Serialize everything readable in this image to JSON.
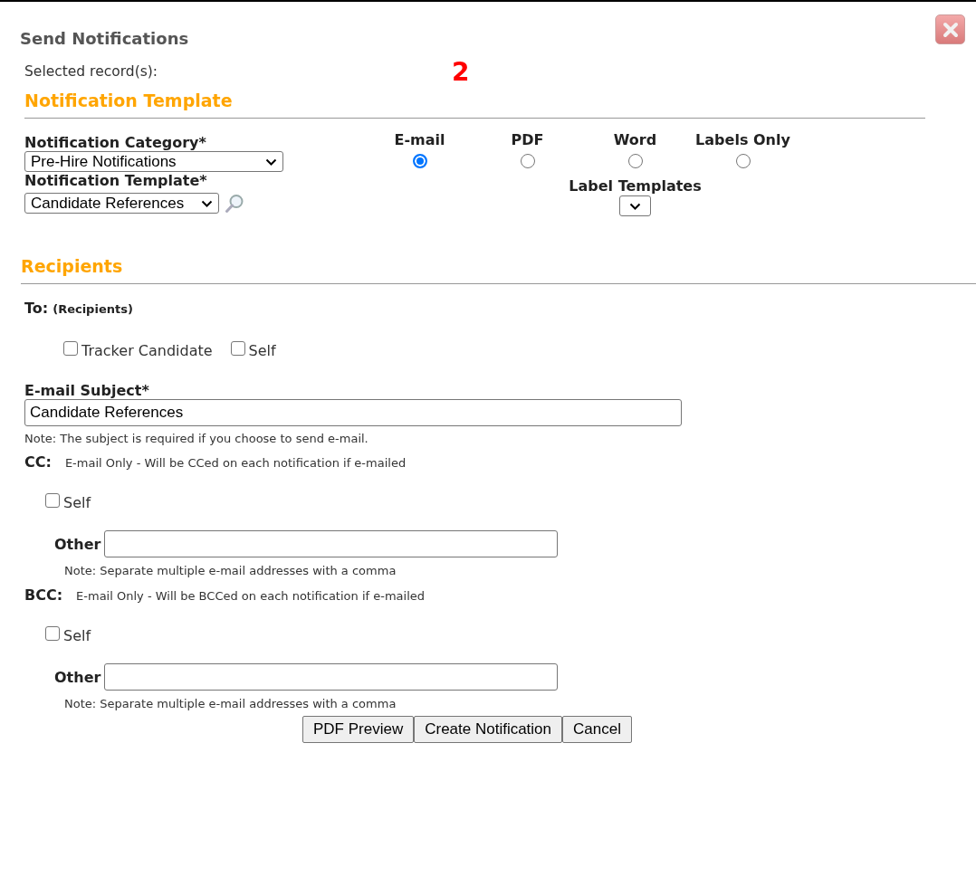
{
  "dialog": {
    "title": "Send Notifications"
  },
  "selected_records": {
    "label": "Selected record(s):",
    "count": "2"
  },
  "template_section": {
    "heading": "Notification Template",
    "fields": [
      {
        "label": "Notification Category*",
        "value": "Pre-Hire Notifications"
      },
      {
        "label": "Notification Template*",
        "value": "Candidate References"
      }
    ],
    "formats": [
      {
        "label": "E-mail",
        "selected": true
      },
      {
        "label": "PDF",
        "selected": false
      },
      {
        "label": "Word",
        "selected": false
      },
      {
        "label": "Labels Only",
        "selected": false
      }
    ],
    "label_templates": {
      "label": "Label Templates"
    }
  },
  "recipients": {
    "heading": "Recipients",
    "to": {
      "label": "To:",
      "hint": "(Recipients)",
      "options": [
        {
          "label": "Tracker Candidate",
          "checked": false
        },
        {
          "label": "Self",
          "checked": false
        }
      ]
    },
    "subject": {
      "label": "E-mail Subject*",
      "value": "Candidate References",
      "note": "Note: The subject is required if you choose to send e-mail."
    },
    "copy_groups": [
      {
        "label": "CC:",
        "description": "E-mail Only - Will be CCed on each notification if e-mailed",
        "self": {
          "label": "Self",
          "checked": false
        },
        "other_label": "Other",
        "note": "Note: Separate multiple e-mail addresses with a comma"
      },
      {
        "label": "BCC:",
        "description": "E-mail Only - Will be BCCed on each notification if e-mailed",
        "self": {
          "label": "Self",
          "checked": false
        },
        "other_label": "Other",
        "note": "Note: Separate multiple e-mail addresses with a comma"
      }
    ]
  },
  "buttons": [
    "PDF Preview",
    "Create Notification",
    "Cancel"
  ]
}
